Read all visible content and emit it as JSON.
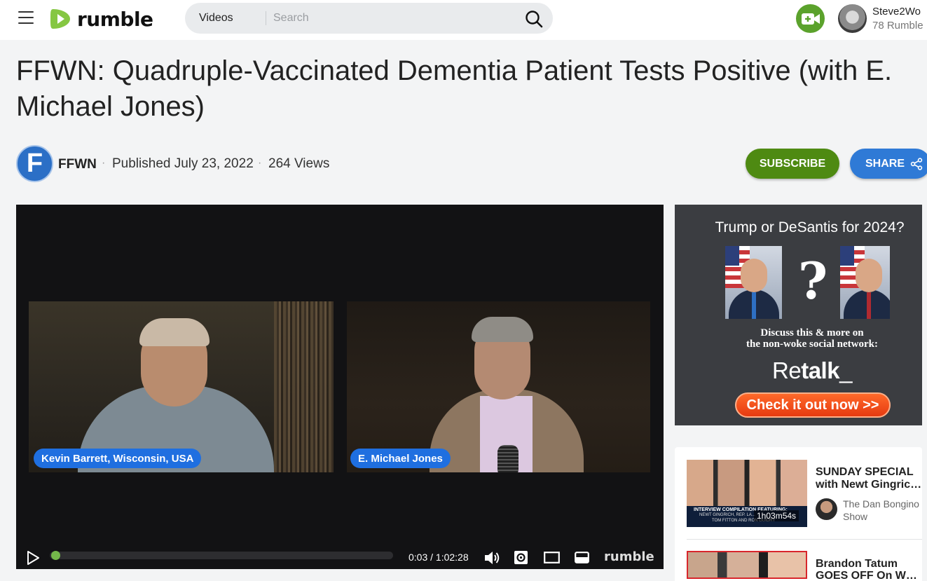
{
  "header": {
    "logo_text": "rumble",
    "search": {
      "category": "Videos",
      "placeholder": "Search"
    },
    "user": {
      "name": "Steve2Wo",
      "subtitle": "78 Rumble"
    },
    "icons": {
      "menu": "hamburger-menu-icon",
      "search": "search-icon",
      "upload": "upload-video-icon"
    }
  },
  "video": {
    "title": "FFWN: Quadruple-Vaccinated Dementia Patient Tests Positive (with E. Michael Jones)",
    "channel": {
      "avatar_letter": "F",
      "name": "FFWN"
    },
    "published": "Published July 23, 2022",
    "views": "264 Views",
    "separator": "·",
    "subscribe_label": "SUBSCRIBE",
    "share_label": "SHARE",
    "colors": {
      "subscribe": "#4e8a12",
      "share": "#2f7ad6",
      "accent": "#74b84a"
    }
  },
  "player": {
    "left_label": "Kevin Barrett, Wisconsin, USA",
    "right_label": "E. Michael Jones",
    "current_time": "0:03",
    "duration": "1:02:28",
    "timecode": "0:03 / 1:02:28",
    "progress_fraction": 0.0008,
    "logo_text": "rumble",
    "controls": [
      "play-icon",
      "volume-icon",
      "settings-icon",
      "theater-mode-icon",
      "fullscreen-icon"
    ]
  },
  "ad": {
    "headline": "Trump or DeSantis for 2024?",
    "question_mark": "?",
    "line1": "Discuss this & more on",
    "line2": "the non-woke social network:",
    "brand_re": "Re",
    "brand_talk": "talk",
    "brand_cursor": "_",
    "cta": "Check it out now >>"
  },
  "related": [
    {
      "title_line1": "SUNDAY SPECIAL",
      "title_line2": "with Newt Gingrich...",
      "duration": "1h03m54s",
      "channel_line1": "The Dan Bongino",
      "channel_line2": "Show",
      "thumb_caption1": "INTERVIEW COMPILATION FEATURING:",
      "thumb_caption2": "NEWT GINGRICH, REP. LA...",
      "thumb_caption3": "TOM FITTON AND RON GUIDRY"
    },
    {
      "title_line1": "Brandon Tatum",
      "title_line2": "GOES OFF On Whi..."
    }
  ]
}
